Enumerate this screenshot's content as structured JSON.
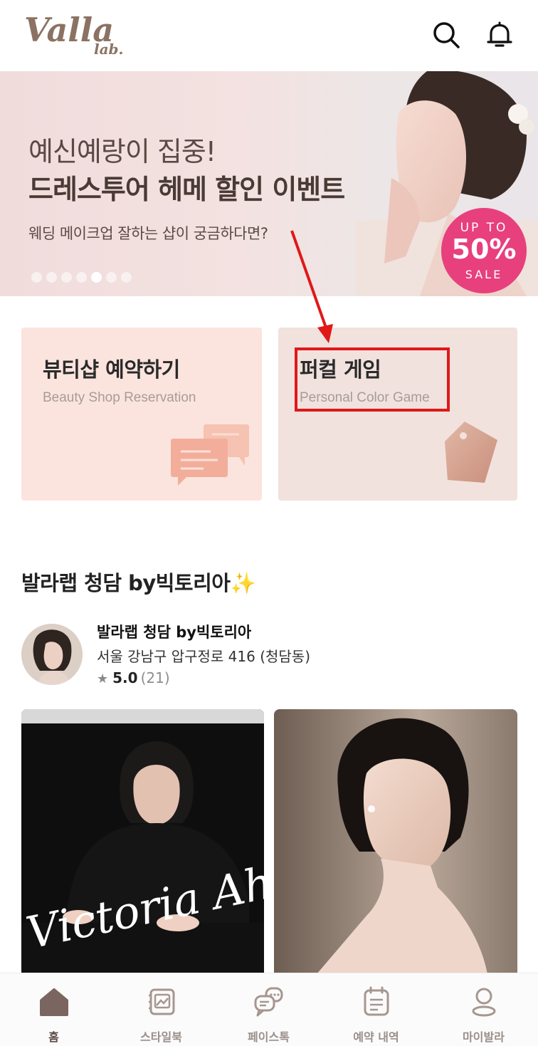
{
  "header": {
    "logo_text": "Valla lab.",
    "search_icon": "search-icon",
    "bell_icon": "bell-icon"
  },
  "banner": {
    "line1": "예신예랑이 집중!",
    "line2": "드레스투어 헤메 할인 이벤트",
    "line3": "웨딩 메이크업 잘하는 샵이 궁금하다면?",
    "sale_top": "UP TO",
    "sale_value": "50%",
    "sale_bottom": "SALE",
    "dots_total": 7,
    "dots_active": 5
  },
  "cards": [
    {
      "title": "뷰티샵 예약하기",
      "subtitle": "Beauty Shop Reservation",
      "icon": "chat-bubbles-icon"
    },
    {
      "title": "퍼컬 게임",
      "subtitle": "Personal Color Game",
      "icon": "tag-icon"
    }
  ],
  "section": {
    "title": "발라랩 청담 by빅토리아✨",
    "shop": {
      "name": "발라랩 청담 by빅토리아",
      "address": "서울 강남구 압구정로 416 (청담동)",
      "rating": "5.0",
      "reviews": "(21)"
    },
    "photo_caption": "Victoria Ahn"
  },
  "bottom_nav": [
    {
      "label": "홈",
      "icon": "home-icon",
      "active": true
    },
    {
      "label": "스타일북",
      "icon": "stylebook-icon",
      "active": false
    },
    {
      "label": "페이스톡",
      "icon": "facetalk-icon",
      "active": false
    },
    {
      "label": "예약 내역",
      "icon": "calendar-icon",
      "active": false
    },
    {
      "label": "마이발라",
      "icon": "profile-icon",
      "active": false
    }
  ],
  "colors": {
    "brand": "#8b7262",
    "sale": "#e7407d",
    "annotation": "#e01818"
  }
}
